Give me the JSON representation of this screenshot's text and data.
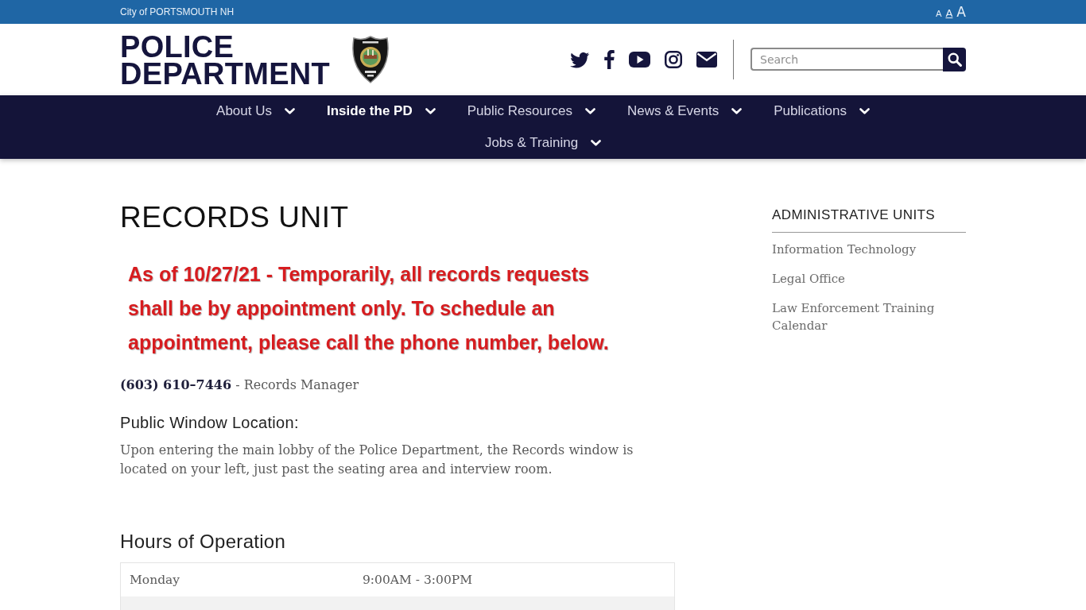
{
  "top_bar": {
    "city_link": "City of PORTSMOUTH NH",
    "text_size_options": [
      {
        "label": "A",
        "kind": "small",
        "selected": false
      },
      {
        "label": "A",
        "kind": "medium",
        "selected": true
      },
      {
        "label": "A",
        "kind": "large",
        "selected": false
      }
    ]
  },
  "header": {
    "title": "POLICE DEPARTMENT",
    "search": {
      "placeholder": "Search"
    }
  },
  "nav": {
    "items": [
      {
        "label": "About Us",
        "selected": false
      },
      {
        "label": "Inside the PD",
        "selected": true
      },
      {
        "label": "Public Resources",
        "selected": false
      },
      {
        "label": "News & Events",
        "selected": false
      },
      {
        "label": "Publications",
        "selected": false
      },
      {
        "label": "Jobs & Training",
        "selected": false
      }
    ]
  },
  "page": {
    "title": "RECORDS UNIT",
    "notice": "As of 10/27/21 - Temporarily, all records requests shall be by appointment only. To schedule an appointment, please call the phone number, below.",
    "contact": "**(603) 610–7446** - Records Manager",
    "sections": [
      {
        "heading": "Public Window Location:",
        "text": "Upon entering the main lobby of the Police Department, the Records window is located on your left, just past the seating area and interview room."
      }
    ],
    "hours": {
      "heading": "Hours of Operation",
      "rows": [
        {
          "day": "Monday",
          "hours": "9:00AM - 3:00PM"
        }
      ]
    }
  },
  "sidebar": {
    "heading": "ADMINISTRATIVE UNITS",
    "links": [
      "Information Technology",
      "Legal Office",
      "Law Enforcement Training Calendar"
    ]
  }
}
